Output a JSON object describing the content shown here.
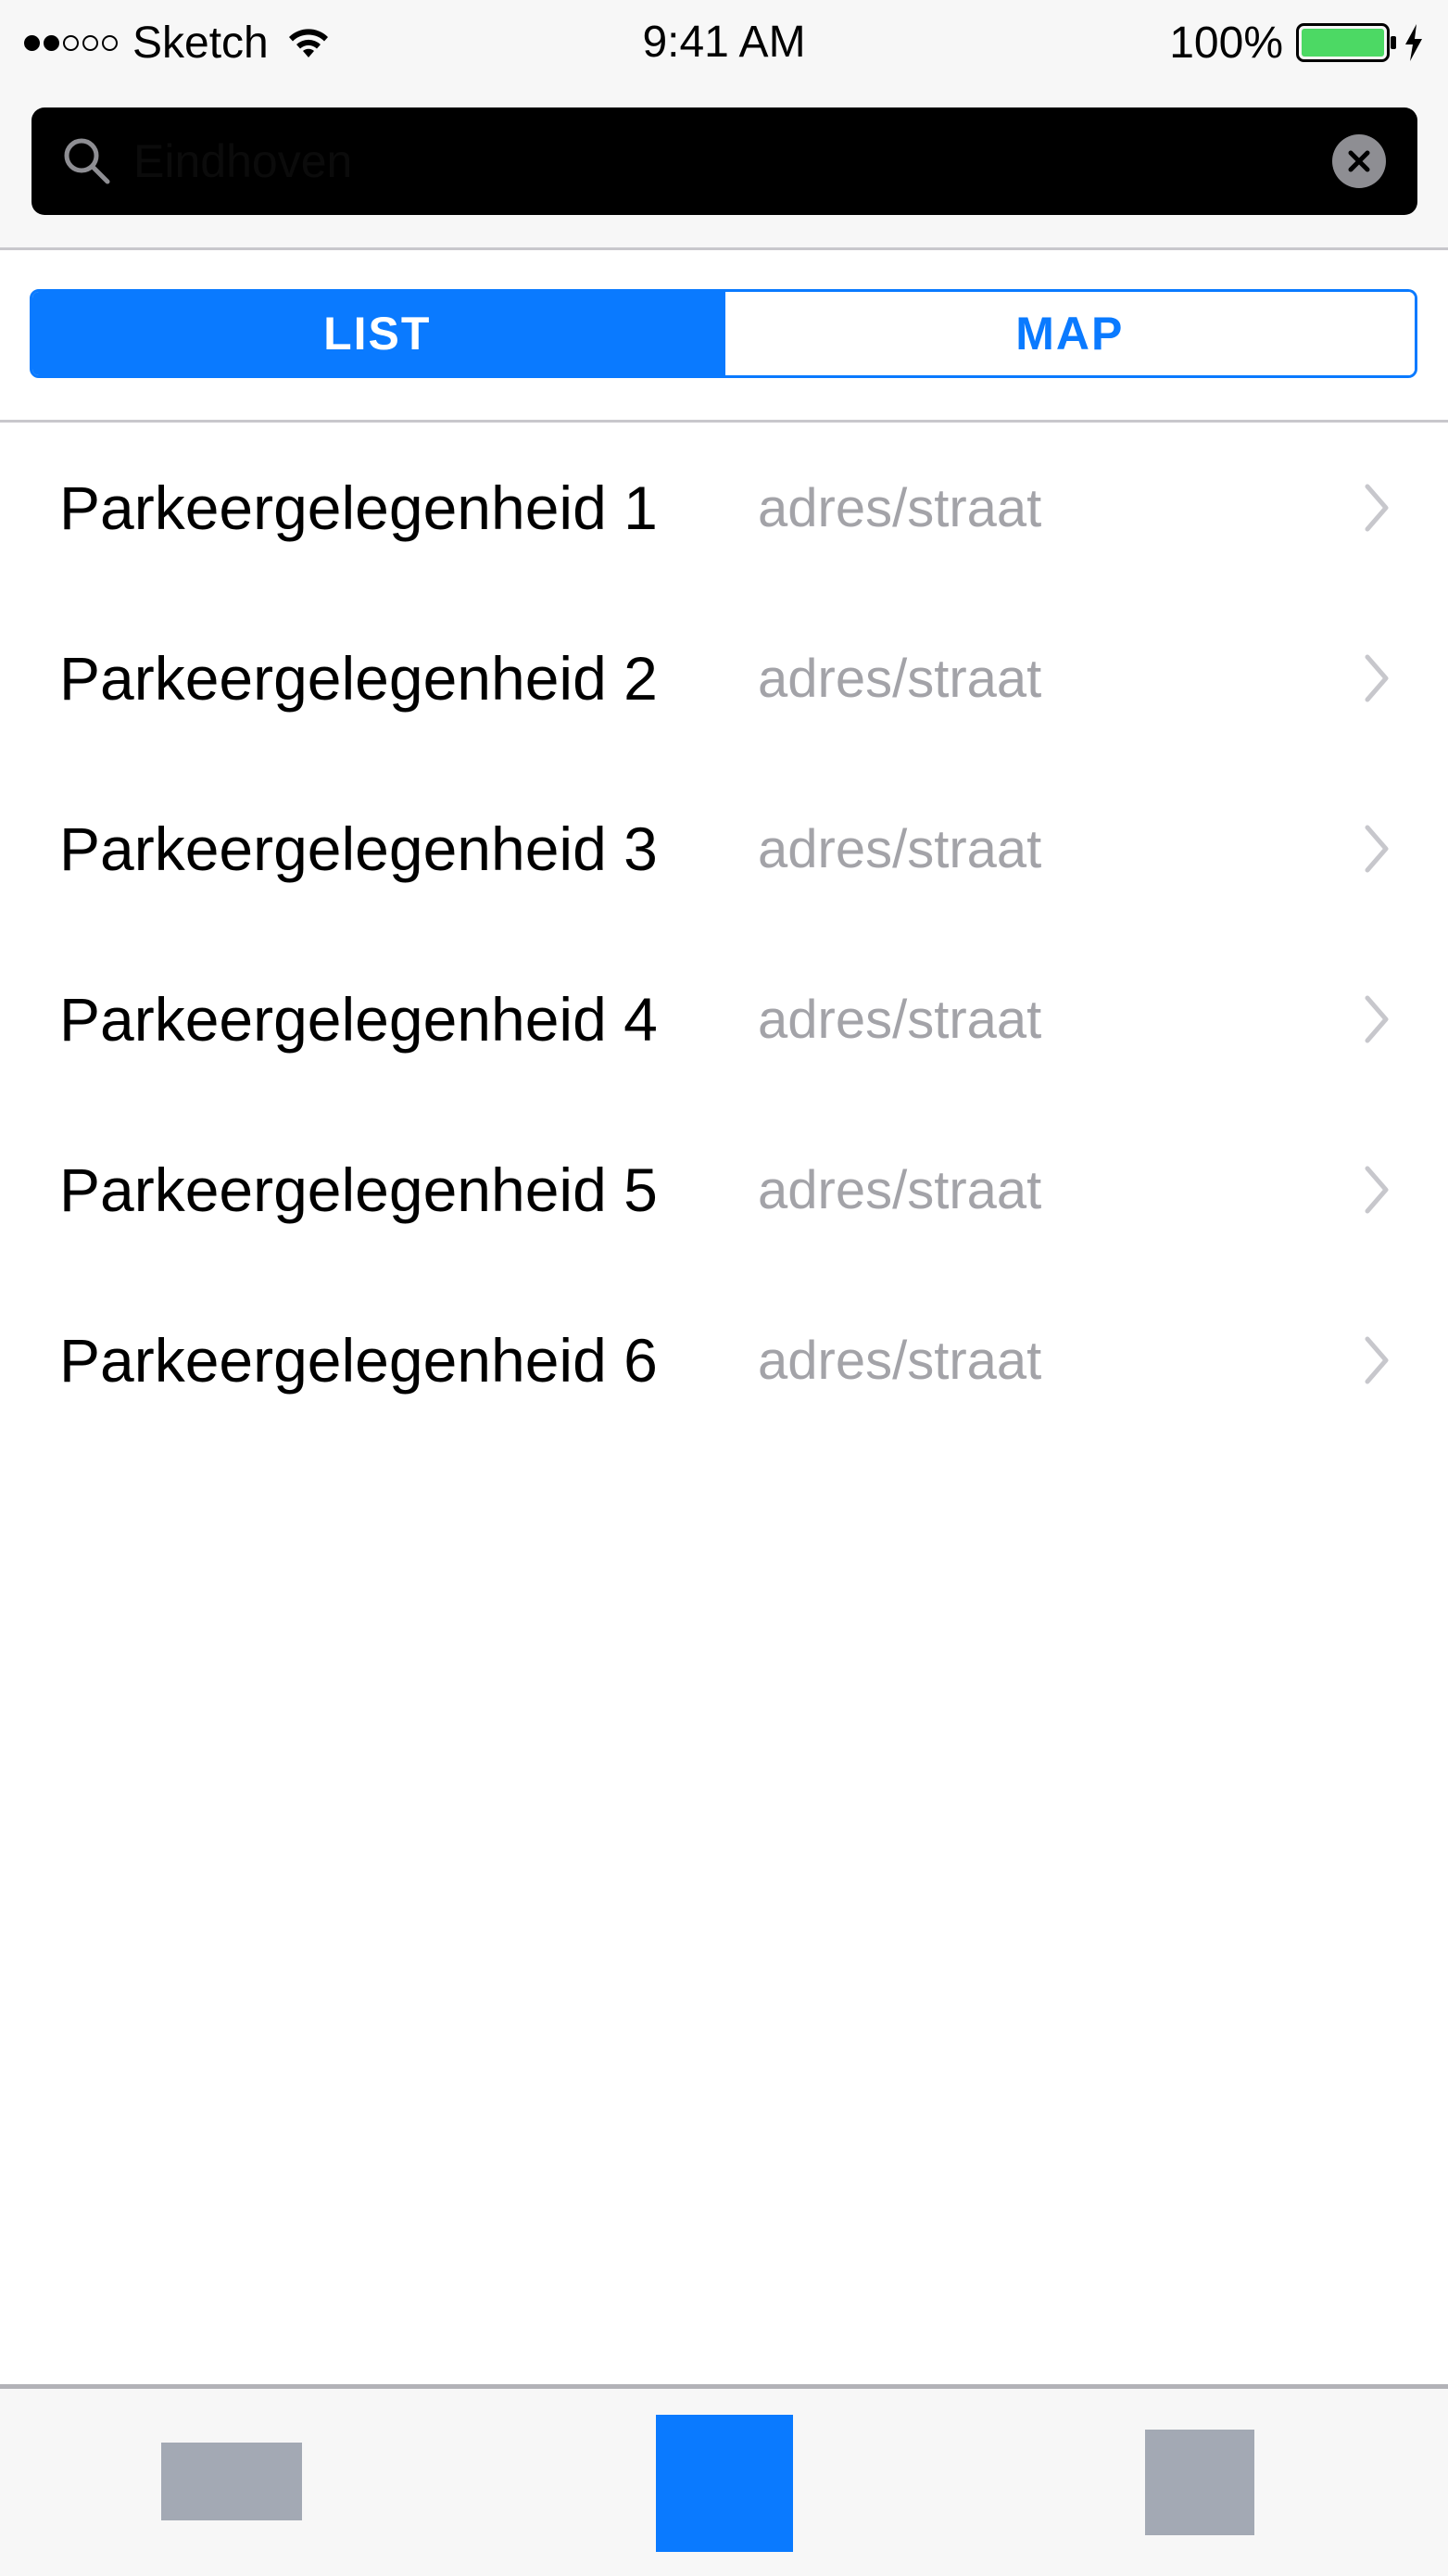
{
  "status_bar": {
    "carrier": "Sketch",
    "time": "9:41 AM",
    "battery_percent": "100%",
    "signal_filled": 2,
    "signal_total": 5
  },
  "search": {
    "value": "Eindhoven",
    "icon": "search-icon",
    "clear_icon": "close-icon"
  },
  "segments": [
    {
      "label": "LIST",
      "selected": true
    },
    {
      "label": "MAP",
      "selected": false
    }
  ],
  "list": {
    "items": [
      {
        "title": "Parkeergelegenheid 1",
        "subtitle": "adres/straat"
      },
      {
        "title": "Parkeergelegenheid 2",
        "subtitle": "adres/straat"
      },
      {
        "title": "Parkeergelegenheid 3",
        "subtitle": "adres/straat"
      },
      {
        "title": "Parkeergelegenheid 4",
        "subtitle": "adres/straat"
      },
      {
        "title": "Parkeergelegenheid 5",
        "subtitle": "adres/straat"
      },
      {
        "title": "Parkeergelegenheid 6",
        "subtitle": "adres/straat"
      }
    ]
  },
  "tab_bar": {
    "selected_index": 1
  },
  "colors": {
    "accent": "#0a7aff",
    "inactive_tab": "#a3a9b4",
    "battery": "#4cd964",
    "secondary_text": "#a3a3a8"
  }
}
